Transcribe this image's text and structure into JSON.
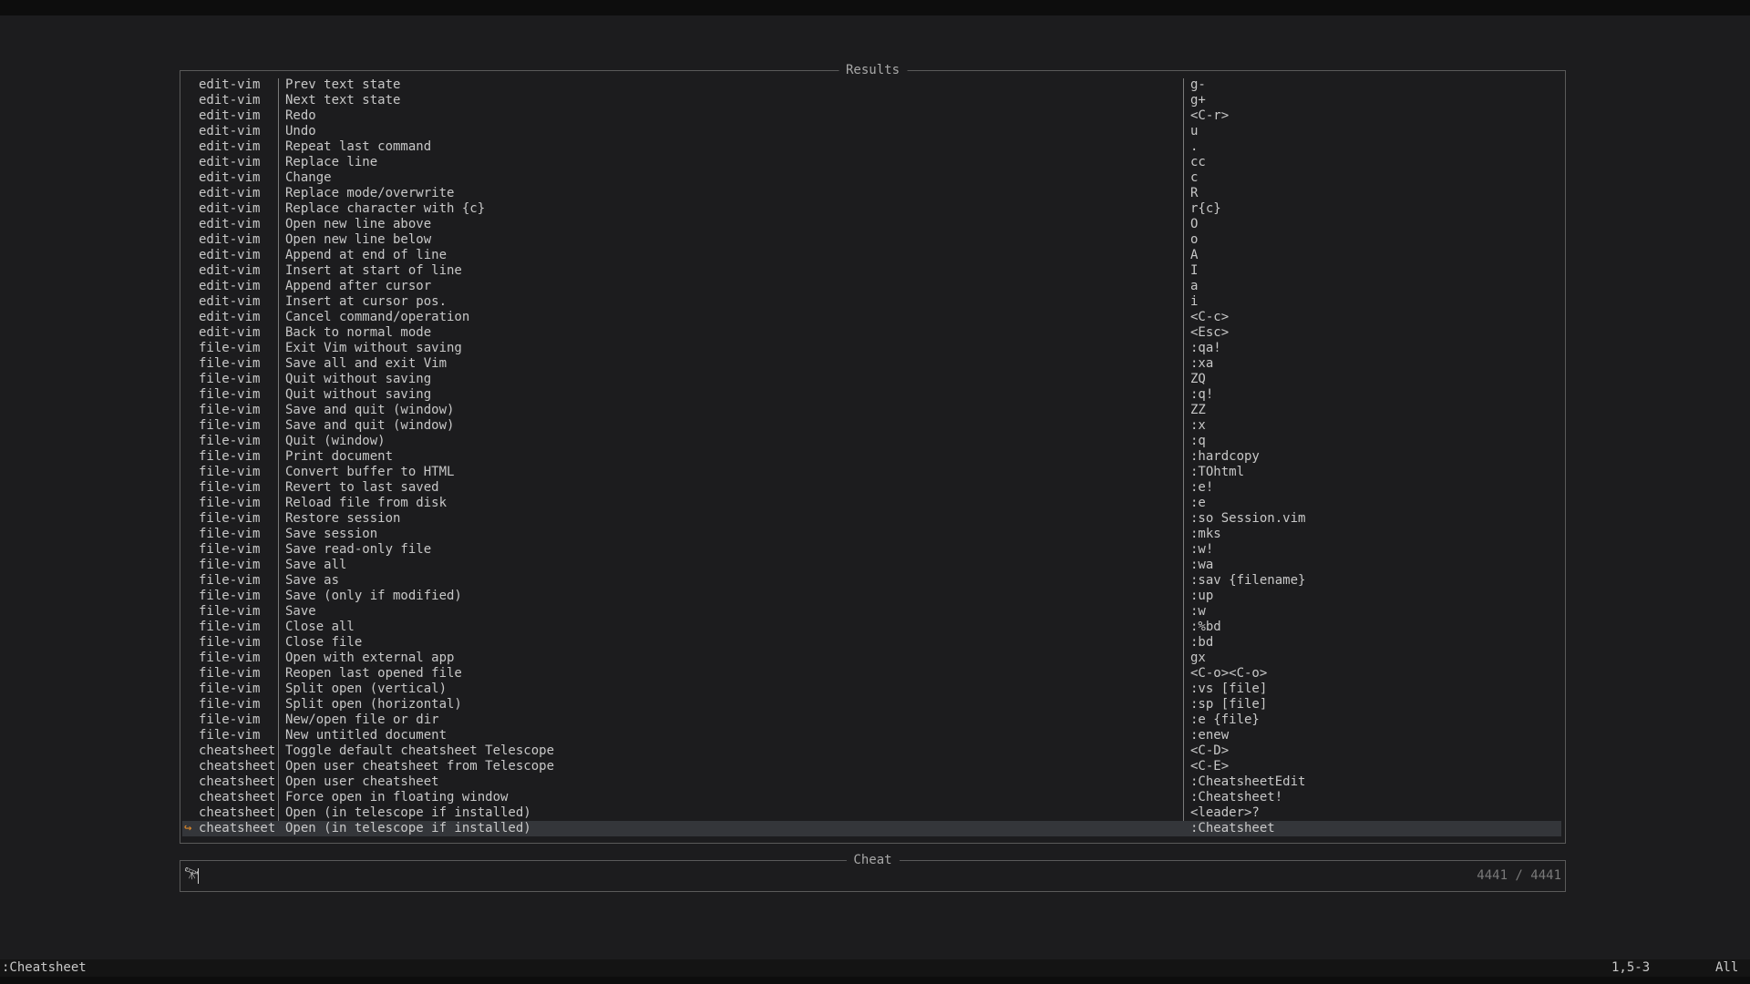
{
  "results_title": "Results",
  "rows": [
    {
      "cat": "edit-vim",
      "desc": "Prev text state",
      "key": "g-"
    },
    {
      "cat": "edit-vim",
      "desc": "Next text state",
      "key": "g+"
    },
    {
      "cat": "edit-vim",
      "desc": "Redo",
      "key": "<C-r>"
    },
    {
      "cat": "edit-vim",
      "desc": "Undo",
      "key": "u"
    },
    {
      "cat": "edit-vim",
      "desc": "Repeat last command",
      "key": "."
    },
    {
      "cat": "edit-vim",
      "desc": "Replace line",
      "key": "cc"
    },
    {
      "cat": "edit-vim",
      "desc": "Change",
      "key": "c"
    },
    {
      "cat": "edit-vim",
      "desc": "Replace mode/overwrite",
      "key": "R"
    },
    {
      "cat": "edit-vim",
      "desc": "Replace character with {c}",
      "key": "r{c}"
    },
    {
      "cat": "edit-vim",
      "desc": "Open new line above",
      "key": "O"
    },
    {
      "cat": "edit-vim",
      "desc": "Open new line below",
      "key": "o"
    },
    {
      "cat": "edit-vim",
      "desc": "Append at end of line",
      "key": "A"
    },
    {
      "cat": "edit-vim",
      "desc": "Insert at start of line",
      "key": "I"
    },
    {
      "cat": "edit-vim",
      "desc": "Append after cursor",
      "key": "a"
    },
    {
      "cat": "edit-vim",
      "desc": "Insert at cursor pos.",
      "key": "i"
    },
    {
      "cat": "edit-vim",
      "desc": "Cancel command/operation",
      "key": "<C-c>"
    },
    {
      "cat": "edit-vim",
      "desc": "Back to normal mode",
      "key": "<Esc>"
    },
    {
      "cat": "file-vim",
      "desc": "Exit Vim without saving",
      "key": ":qa!"
    },
    {
      "cat": "file-vim",
      "desc": "Save all and exit Vim",
      "key": ":xa"
    },
    {
      "cat": "file-vim",
      "desc": "Quit without saving",
      "key": "ZQ"
    },
    {
      "cat": "file-vim",
      "desc": "Quit without saving",
      "key": ":q!"
    },
    {
      "cat": "file-vim",
      "desc": "Save and quit (window)",
      "key": "ZZ"
    },
    {
      "cat": "file-vim",
      "desc": "Save and quit (window)",
      "key": ":x"
    },
    {
      "cat": "file-vim",
      "desc": "Quit (window)",
      "key": ":q"
    },
    {
      "cat": "file-vim",
      "desc": "Print document",
      "key": ":hardcopy"
    },
    {
      "cat": "file-vim",
      "desc": "Convert buffer to HTML",
      "key": ":TOhtml"
    },
    {
      "cat": "file-vim",
      "desc": "Revert to last saved",
      "key": ":e!"
    },
    {
      "cat": "file-vim",
      "desc": "Reload file from disk",
      "key": ":e"
    },
    {
      "cat": "file-vim",
      "desc": "Restore session",
      "key": ":so Session.vim"
    },
    {
      "cat": "file-vim",
      "desc": "Save session",
      "key": ":mks"
    },
    {
      "cat": "file-vim",
      "desc": "Save read-only file",
      "key": ":w!"
    },
    {
      "cat": "file-vim",
      "desc": "Save all",
      "key": ":wa"
    },
    {
      "cat": "file-vim",
      "desc": "Save as",
      "key": ":sav {filename}"
    },
    {
      "cat": "file-vim",
      "desc": "Save (only if modified)",
      "key": ":up"
    },
    {
      "cat": "file-vim",
      "desc": "Save",
      "key": ":w"
    },
    {
      "cat": "file-vim",
      "desc": "Close all",
      "key": ":%bd"
    },
    {
      "cat": "file-vim",
      "desc": "Close file",
      "key": ":bd"
    },
    {
      "cat": "file-vim",
      "desc": "Open with external app",
      "key": "gx"
    },
    {
      "cat": "file-vim",
      "desc": "Reopen last opened file",
      "key": "<C-o><C-o>"
    },
    {
      "cat": "file-vim",
      "desc": "Split open (vertical)",
      "key": ":vs [file]"
    },
    {
      "cat": "file-vim",
      "desc": "Split open (horizontal)",
      "key": ":sp [file]"
    },
    {
      "cat": "file-vim",
      "desc": "New/open file or dir",
      "key": ":e {file}"
    },
    {
      "cat": "file-vim",
      "desc": "New untitled document",
      "key": ":enew"
    },
    {
      "cat": "cheatsheet",
      "desc": "Toggle default cheatsheet Telescope",
      "key": "<C-D>"
    },
    {
      "cat": "cheatsheet",
      "desc": "Open user cheatsheet from Telescope",
      "key": "<C-E>"
    },
    {
      "cat": "cheatsheet",
      "desc": "Open user cheatsheet",
      "key": ":CheatsheetEdit"
    },
    {
      "cat": "cheatsheet",
      "desc": "Force open in floating window",
      "key": ":Cheatsheet!"
    },
    {
      "cat": "cheatsheet",
      "desc": "Open (in telescope if installed)",
      "key": "<leader>?"
    },
    {
      "cat": "cheatsheet",
      "desc": "Open (in telescope if installed)",
      "key": ":Cheatsheet",
      "selected": true
    }
  ],
  "prompt": {
    "title": "Cheat",
    "value": "",
    "count": "4441 / 4441"
  },
  "status": {
    "cmdline": ":Cheatsheet",
    "position": "1,5-3",
    "scroll": "All"
  },
  "colors": {
    "background": "#1c1c1e",
    "selection": "#34363a",
    "caret": "#e08a2a"
  }
}
